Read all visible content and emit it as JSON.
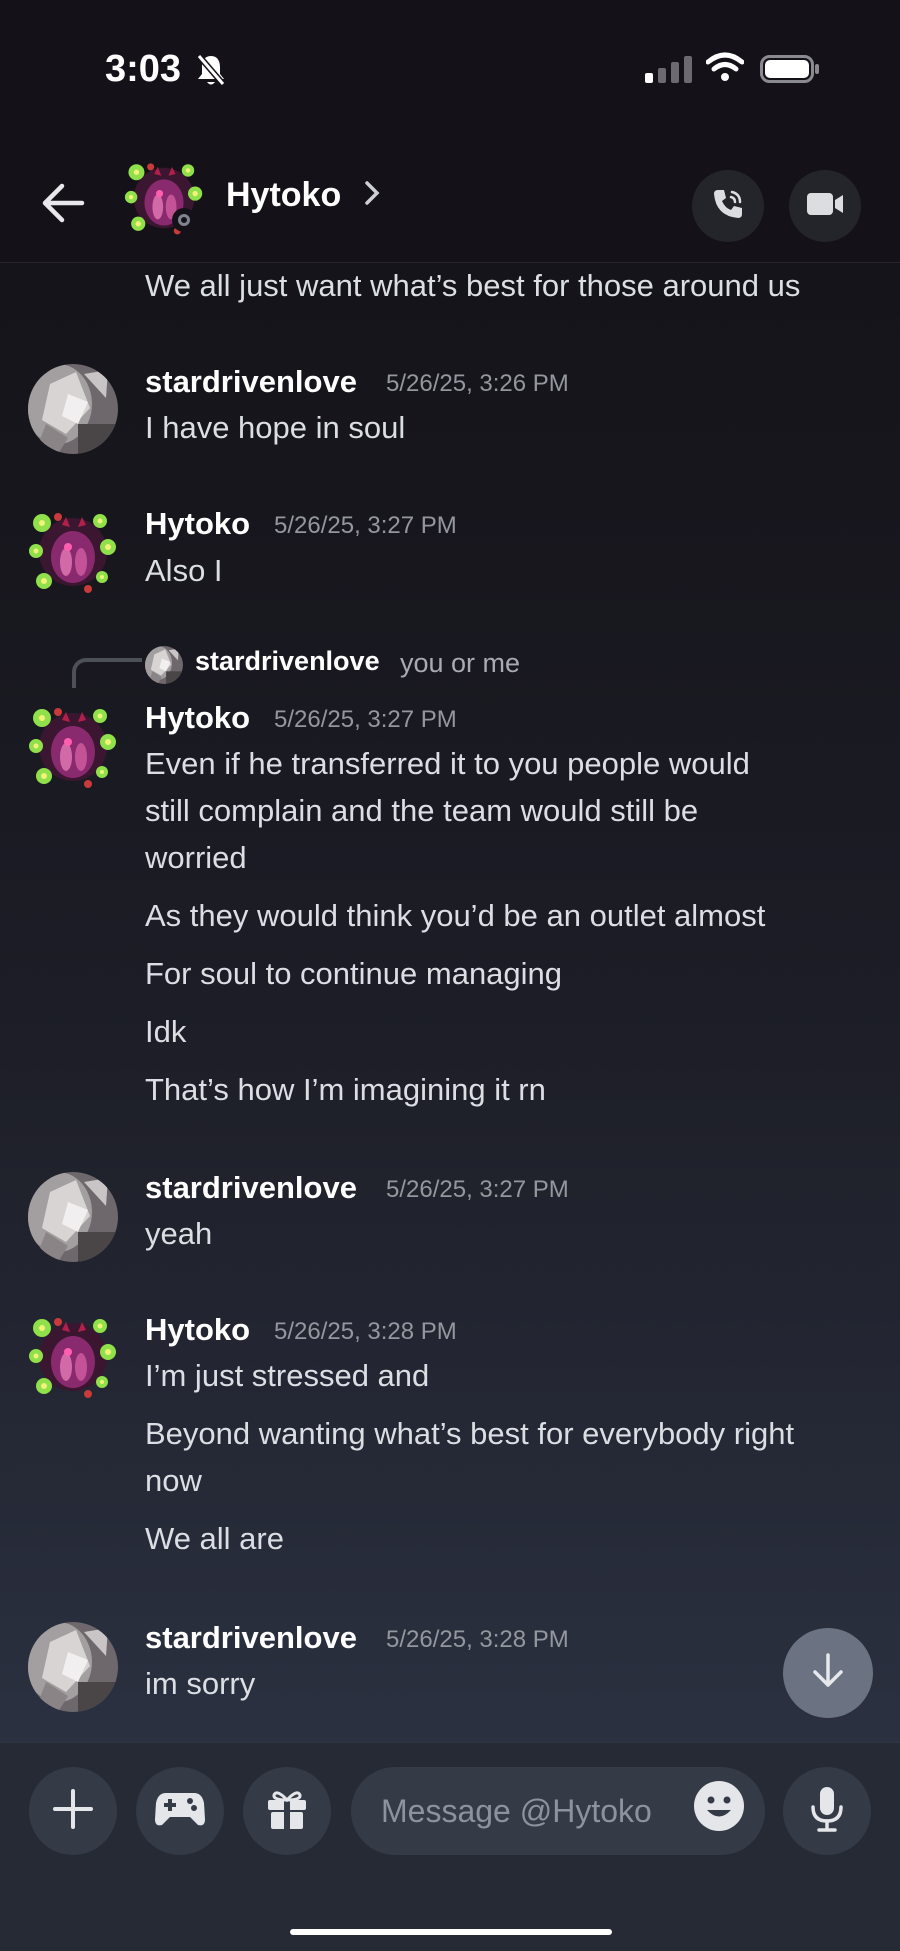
{
  "status_bar": {
    "time": "3:03",
    "signal_bars_active": 1
  },
  "header": {
    "name": "Hytoko",
    "status": "offline"
  },
  "messages": {
    "m0": {
      "lines": [
        "We all just want what’s best for those around us"
      ]
    },
    "m1": {
      "author": "stardrivenlove",
      "time": "5/26/25, 3:26 PM",
      "lines": [
        "I have hope in soul"
      ]
    },
    "m2": {
      "author": "Hytoko",
      "time": "5/26/25, 3:27 PM",
      "lines": [
        "Also I"
      ]
    },
    "m3": {
      "reply_to": {
        "author": "stardrivenlove",
        "text": "you or me"
      },
      "author": "Hytoko",
      "time": "5/26/25, 3:27 PM",
      "lines": [
        "Even if he transferred it to you people would",
        "still complain and the team would still be",
        "worried",
        "As they would think you’d be an outlet almost",
        "For soul to continue managing",
        "Idk",
        "That’s how I’m imagining it rn"
      ]
    },
    "m4": {
      "author": "stardrivenlove",
      "time": "5/26/25, 3:27 PM",
      "lines": [
        "yeah"
      ]
    },
    "m5": {
      "author": "Hytoko",
      "time": "5/26/25, 3:28 PM",
      "lines": [
        "I’m just stressed and",
        "Beyond wanting what’s best for everybody right",
        "now",
        "We all are"
      ]
    },
    "m6": {
      "author": "stardrivenlove",
      "time": "5/26/25, 3:28 PM",
      "lines": [
        "im sorry"
      ]
    }
  },
  "composer": {
    "placeholder": "Message @Hytoko"
  },
  "icons": [
    "bell-slash-icon",
    "signal-icon",
    "wifi-icon",
    "battery-icon",
    "back-arrow-icon",
    "chevron-right-icon",
    "phone-call-icon",
    "video-camera-icon",
    "arrow-down-icon",
    "plus-icon",
    "gamepad-icon",
    "gift-icon",
    "emoji-icon",
    "microphone-icon"
  ],
  "colors": {
    "background_top": "#141218",
    "background_bottom": "#2b3141",
    "text": "#dbdee3",
    "timestamp": "#94979e",
    "composer": "#262a34",
    "button": "#353a47"
  }
}
